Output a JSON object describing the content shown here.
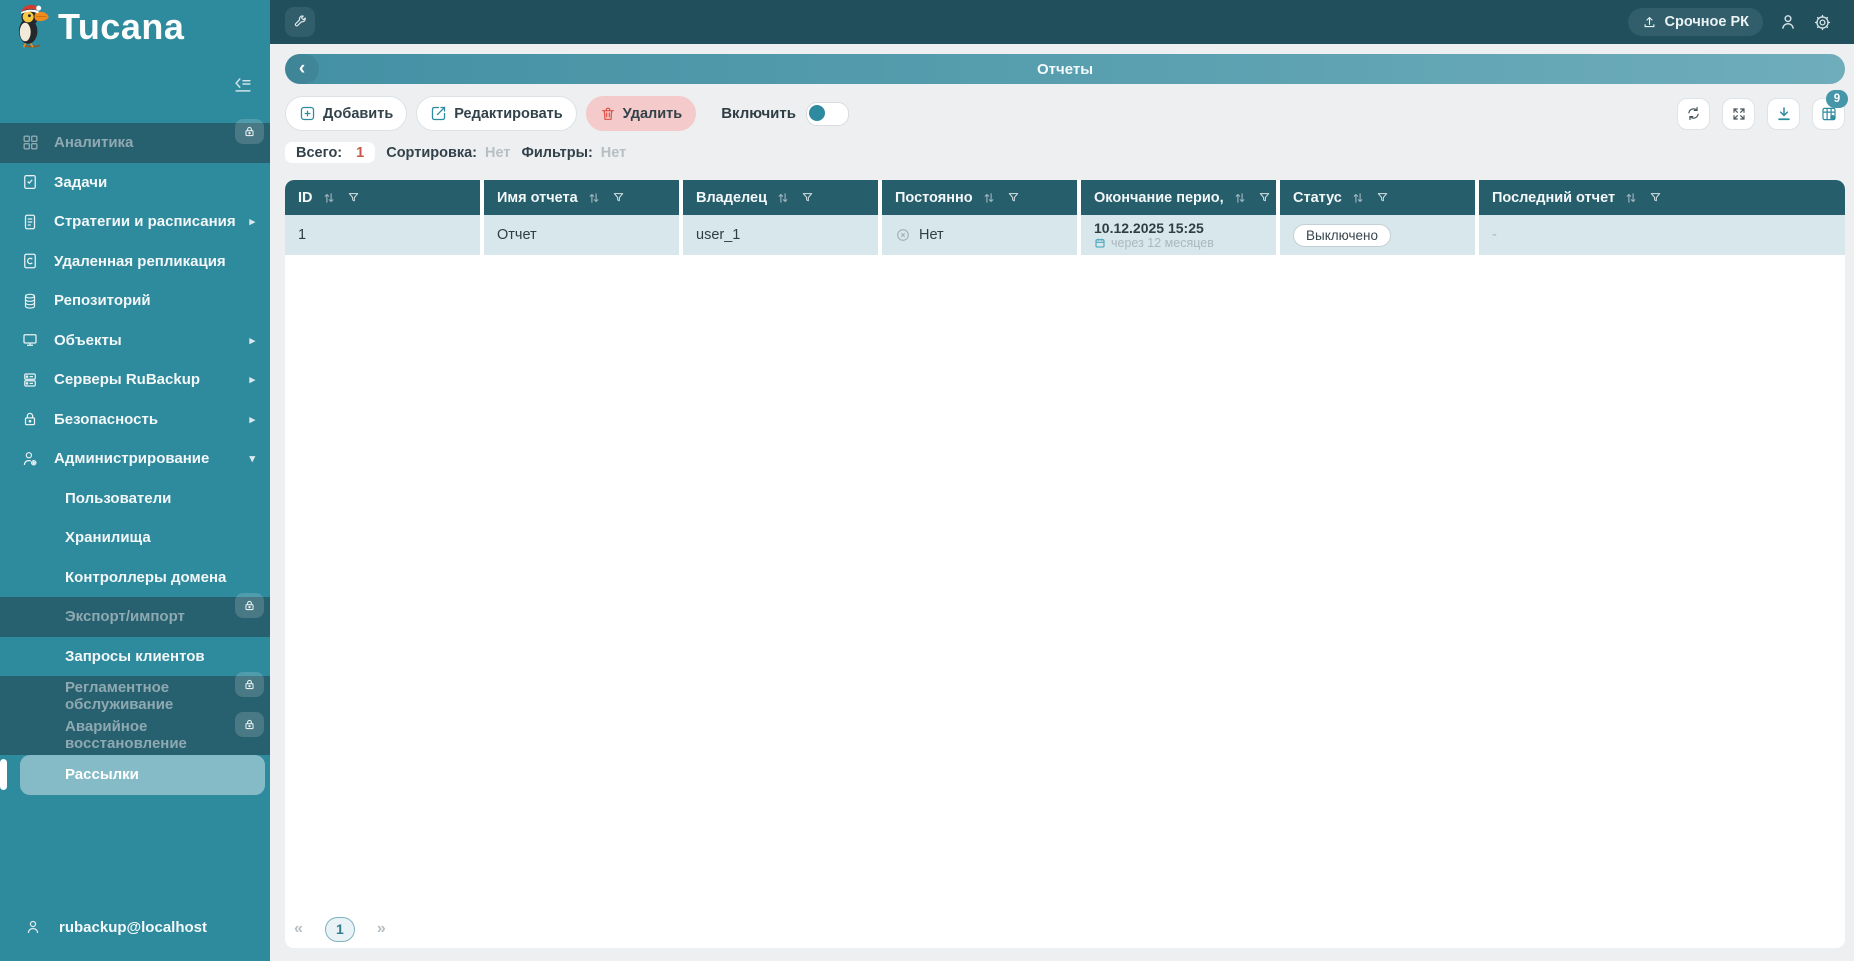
{
  "app": {
    "name": "Tucana",
    "user_email": "rubackup@localhost"
  },
  "icons": {
    "back": "‹",
    "chevron_right": "▸",
    "chevron_down": "▾",
    "pager_prev": "«",
    "pager_next": "»"
  },
  "topbar": {
    "urgent_button": "Срочное РК"
  },
  "sidebar": {
    "items": [
      {
        "label": "Аналитика",
        "locked": true
      },
      {
        "label": "Задачи"
      },
      {
        "label": "Стратегии и расписания",
        "arrow": "right"
      },
      {
        "label": "Удаленная репликация"
      },
      {
        "label": "Репозиторий"
      },
      {
        "label": "Объекты",
        "arrow": "right"
      },
      {
        "label": "Серверы RuBackup",
        "arrow": "right"
      },
      {
        "label": "Безопасность",
        "arrow": "right"
      },
      {
        "label": "Администрирование",
        "arrow": "down"
      }
    ],
    "admin_children": [
      {
        "label": "Пользователи"
      },
      {
        "label": "Хранилища"
      },
      {
        "label": "Контроллеры домена"
      },
      {
        "label": "Экспорт/импорт",
        "locked": true
      },
      {
        "label": "Запросы клиентов"
      },
      {
        "label": "Регламентное обслуживание",
        "locked": true
      },
      {
        "label": "Аварийное восстановление",
        "locked": true
      },
      {
        "label": "Рассылки",
        "selected": true
      }
    ]
  },
  "page": {
    "title": "Отчеты"
  },
  "toolbar": {
    "add": "Добавить",
    "edit": "Редактировать",
    "delete": "Удалить",
    "enable_label": "Включить",
    "enable_state": "off",
    "badge_count": "9"
  },
  "meta": {
    "total_label": "Всего:",
    "total_value": "1",
    "sort_label": "Сортировка:",
    "sort_value": "Нет",
    "filter_label": "Фильтры:",
    "filter_value": "Нет"
  },
  "table": {
    "columns": [
      "ID",
      "Имя отчета",
      "Владелец",
      "Постоянно",
      "Окончание перио,",
      "Статус",
      "Последний отчет"
    ],
    "row": {
      "id": "1",
      "name": "Отчет",
      "owner": "user_1",
      "permanent": "Нет",
      "period_end": "10.12.2025 15:25",
      "period_end_hint": "через 12 месяцев",
      "status": "Выключено",
      "last_report": "-"
    }
  },
  "pagination": {
    "page": "1"
  },
  "colors": {
    "accent": "#2E8A9E",
    "danger": "#DD5147",
    "sidebar": "#2E8A9D",
    "header": "#275E6B"
  }
}
